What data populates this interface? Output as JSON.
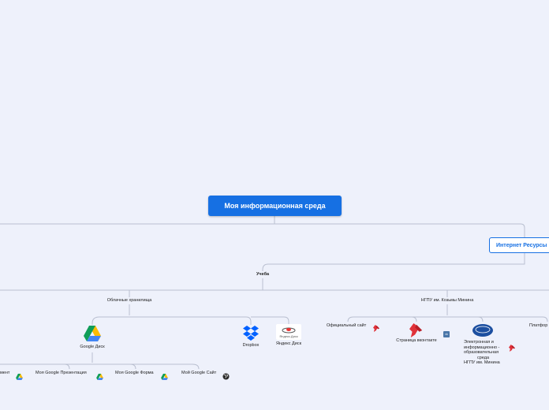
{
  "root": {
    "title": "Моя информационная среда"
  },
  "branch": {
    "title": "Интернет Ресурсы"
  },
  "study": {
    "title": "Учеба"
  },
  "cloud": {
    "title": "Облачные хранилища",
    "google_drive": "Google Диск",
    "dropbox": "Dropbox",
    "yandex_disk": "Яндекс Диск",
    "yandex_logo_text": "Яндекс.Диск",
    "docs": {
      "doc": "мент",
      "presentation": "Моя Google Презентация",
      "form": "Моя Google Форма",
      "site": "Мой Google Сайт"
    }
  },
  "university": {
    "title": "НГПУ им. Козьмы Минина",
    "official_site": "Официальный сайт",
    "vk_page": "Страница вконтакте",
    "vk_badge": "vk",
    "eios": [
      "Электронная и",
      "информационно -",
      "образовательная",
      "среда",
      "НГПУ им. Минина"
    ],
    "platform": "Платфор"
  },
  "colors": {
    "background": "#eef1fb",
    "root_fill": "#1670e3",
    "branch_border": "#1670e3",
    "lines": "#b9bfd0",
    "pin_red": "#e0323a"
  },
  "icons": {
    "pin": "red-pin-icon",
    "drive": "google-drive-icon",
    "dropbox": "dropbox-icon",
    "globe": "globe-icon",
    "vk": "vk-icon"
  }
}
